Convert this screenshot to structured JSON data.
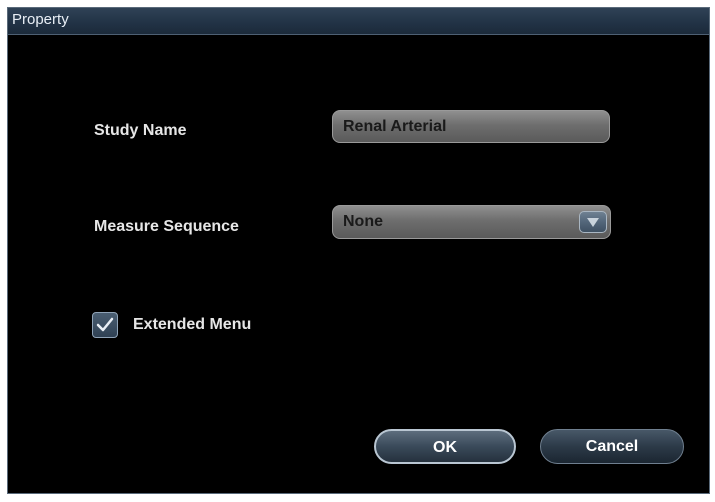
{
  "dialog": {
    "title": "Property"
  },
  "study_name": {
    "label": "Study Name",
    "value": "Renal Arterial"
  },
  "measure_sequence": {
    "label": "Measure Sequence",
    "selected": "None",
    "dropdown_icon": "triangle-down-icon"
  },
  "extended_menu": {
    "label": "Extended Menu",
    "checked": true,
    "icon": "checkmark-icon"
  },
  "buttons": {
    "ok": "OK",
    "cancel": "Cancel"
  },
  "colors": {
    "background": "#000000",
    "title_bar": "#223346",
    "field_fill": "#6e6e6e",
    "label_text": "#e6e6e6"
  }
}
